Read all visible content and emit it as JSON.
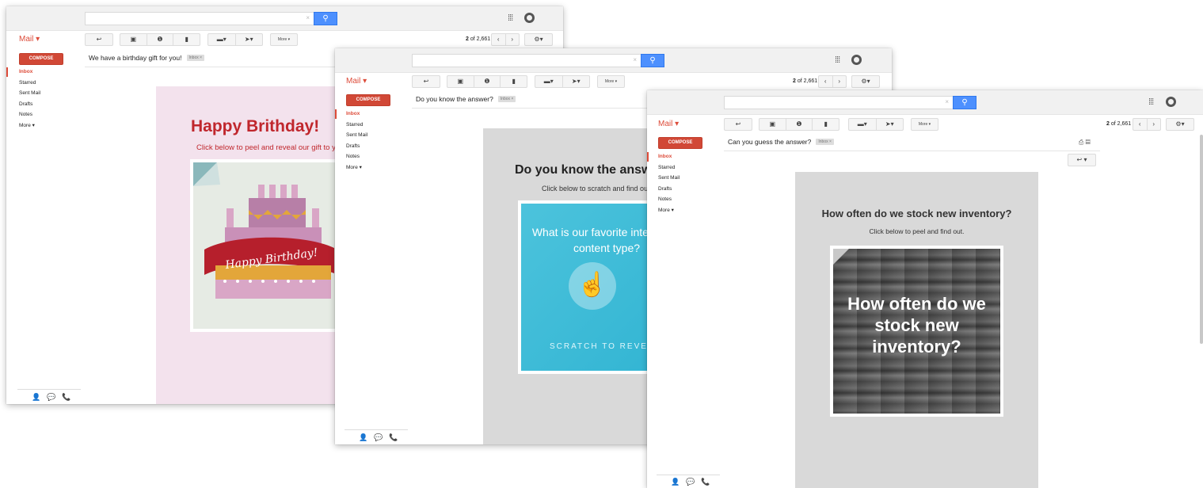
{
  "gmail": {
    "mail_label": "Mail ▾",
    "compose": "COMPOSE",
    "nav": [
      "Inbox",
      "Starred",
      "Sent Mail",
      "Drafts",
      "Notes",
      "More ▾"
    ],
    "more_button": "More ▾",
    "page_count_bold": "2",
    "page_count_rest": " of 2,661",
    "badge": "Inbox",
    "search_clear": "×",
    "footer_icons": "👤💬📞"
  },
  "windows": [
    {
      "subject": "We have a birthday gift for you!",
      "headline": "Happy Brithday!",
      "subline": "Click below to peel and reveal our gift to you",
      "art_text": "Happy Birthday!"
    },
    {
      "subject": "Do you know the answer?",
      "headline": "Do you know the answer?",
      "subline": "Click below to scratch and find out.",
      "art_text": "What is our favorite interactive content type?",
      "art_cta": "SCRATCH TO REVEAL"
    },
    {
      "subject": "Can you guess the answer?",
      "headline": "How often do we stock new inventory?",
      "subline": "Click below to peel and find out.",
      "art_text": "How often do we stock new inventory?"
    }
  ],
  "colors": {
    "gmail_red": "#dd4b39",
    "compose_red": "#d14836",
    "search_blue": "#4d90fe",
    "birthday_bg": "#f3e2ed",
    "birthday_red": "#c0272d",
    "gray_bg": "#d9d9d9",
    "scratch_teal": "#35b8d6"
  }
}
